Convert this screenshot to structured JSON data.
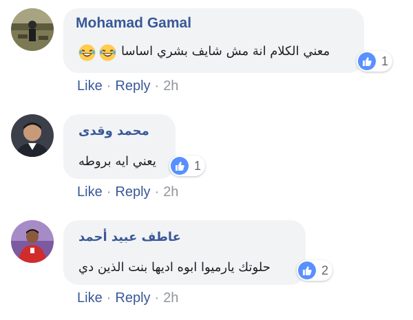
{
  "comments": [
    {
      "author": "Mohamad Gamal",
      "text": "معني الكلام انة مش شايف بشري اساسا",
      "has_emojis": true,
      "reaction_count": "1",
      "actions": {
        "like": "Like",
        "reply": "Reply",
        "time": "2h"
      }
    },
    {
      "author": "محمد وقدى",
      "text": "يعني ايه بروطه",
      "has_emojis": false,
      "reaction_count": "1",
      "actions": {
        "like": "Like",
        "reply": "Reply",
        "time": "2h"
      }
    },
    {
      "author": "عاطف عبيد أحمد",
      "text": "حلوتك يارميوا ابوه اديها بنت الذين دي",
      "has_emojis": false,
      "reaction_count": "2",
      "actions": {
        "like": "Like",
        "reply": "Reply",
        "time": "2h"
      }
    }
  ],
  "separator": "·",
  "colors": {
    "link": "#385898",
    "meta": "#90949c",
    "bubble": "#f2f3f5",
    "like_badge": "#5890ff",
    "emoji_face": "#ffcc4d"
  },
  "icons": [
    "avatar",
    "laughing-emoji-icon",
    "like-thumb-icon"
  ]
}
